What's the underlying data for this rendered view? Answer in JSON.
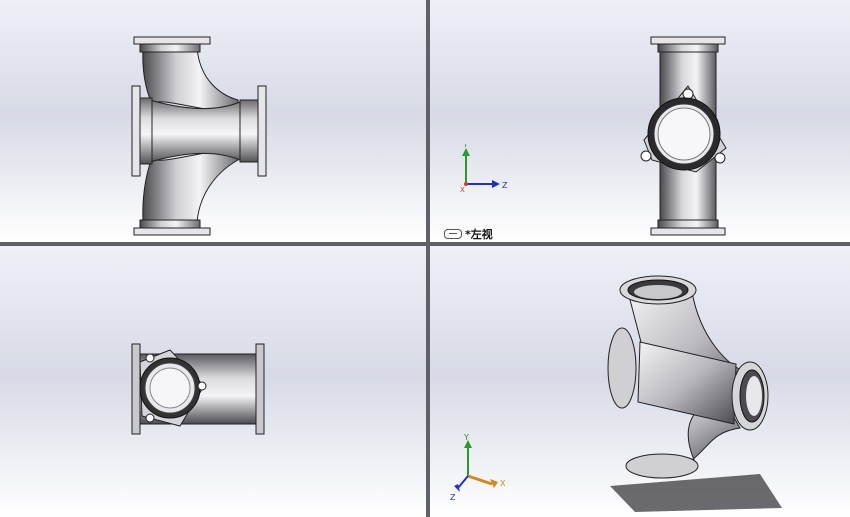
{
  "viewports": {
    "top_left": {
      "name": "front-view"
    },
    "top_right": {
      "name": "left-view",
      "label": "*左视"
    },
    "bottom_left": {
      "name": "top-view"
    },
    "bottom_right": {
      "name": "isometric-view"
    }
  },
  "triad_axes": {
    "x": "X",
    "y": "Y",
    "z": "Z"
  },
  "colors": {
    "axis_x": "#d04020",
    "axis_y": "#2a9a2a",
    "axis_z": "#2030c0",
    "axis_iso_x": "#d08a20",
    "metal_dark": "#3a3a3e",
    "metal_light": "#f2f2f4"
  },
  "icons": {
    "display_state": "link-icon"
  }
}
